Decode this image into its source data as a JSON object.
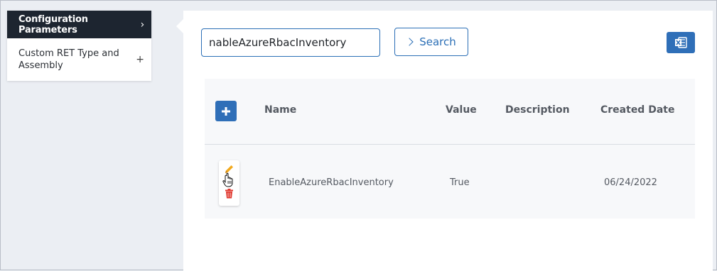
{
  "sidebar": {
    "active_item": "Configuration Parameters",
    "items": [
      {
        "label": "Custom RET Type and Assembly"
      }
    ]
  },
  "search": {
    "value": "nableAzureRbacInventory",
    "button_label": "Search"
  },
  "table": {
    "columns": [
      "Name",
      "Value",
      "Description",
      "Created Date"
    ],
    "rows": [
      {
        "name": "EnableAzureRbacInventory",
        "value": "True",
        "description": "",
        "created_date": "06/24/2022"
      }
    ]
  },
  "colors": {
    "accent": "#2f6fb8",
    "sidebar_active_bg": "#1d2530",
    "edit_icon": "#f2a91d",
    "delete_icon": "#e0362c"
  },
  "icons": {
    "export": "excel-icon",
    "add": "plus-icon",
    "edit": "pencil-icon",
    "delete": "trash-icon"
  }
}
